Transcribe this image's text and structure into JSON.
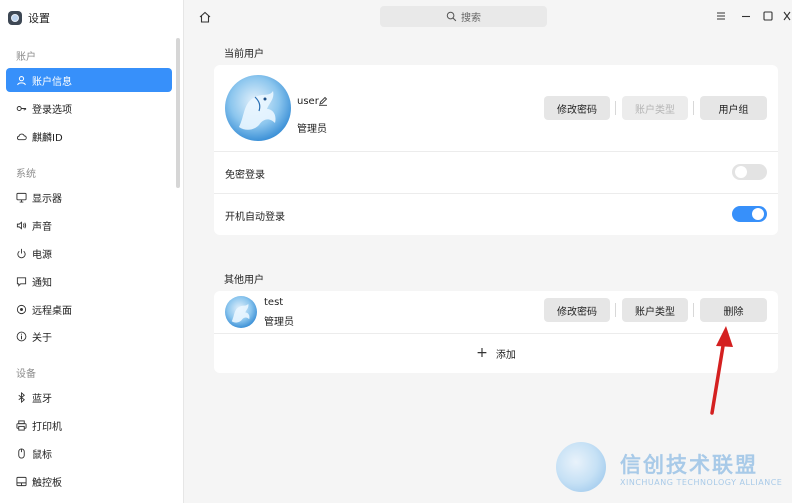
{
  "app": {
    "title": "设置"
  },
  "search": {
    "placeholder": "搜索"
  },
  "sidebar": {
    "groups": [
      {
        "label": "账户"
      },
      {
        "label": "系统"
      },
      {
        "label": "设备"
      }
    ],
    "items": [
      {
        "label": "账户信息",
        "icon": "user-icon",
        "active": true
      },
      {
        "label": "登录选项",
        "icon": "key-icon"
      },
      {
        "label": "麒麟ID",
        "icon": "cloud-icon"
      },
      {
        "label": "显示器",
        "icon": "monitor-icon"
      },
      {
        "label": "声音",
        "icon": "speaker-icon"
      },
      {
        "label": "电源",
        "icon": "power-icon"
      },
      {
        "label": "通知",
        "icon": "message-icon"
      },
      {
        "label": "远程桌面",
        "icon": "remote-desktop-icon"
      },
      {
        "label": "关于",
        "icon": "info-icon"
      },
      {
        "label": "蓝牙",
        "icon": "bluetooth-icon"
      },
      {
        "label": "打印机",
        "icon": "printer-icon"
      },
      {
        "label": "鼠标",
        "icon": "mouse-icon"
      },
      {
        "label": "触控板",
        "icon": "touchpad-icon"
      }
    ]
  },
  "current_user": {
    "section_title": "当前用户",
    "username": "user",
    "role": "管理员",
    "buttons": {
      "change_password": "修改密码",
      "account_type": "账户类型",
      "user_group": "用户组"
    },
    "passwordless_login": {
      "label": "免密登录",
      "enabled": false
    },
    "auto_login": {
      "label": "开机自动登录",
      "enabled": true
    }
  },
  "other_users": {
    "section_title": "其他用户",
    "users": [
      {
        "username": "test",
        "role": "管理员",
        "buttons": {
          "change_password": "修改密码",
          "account_type": "账户类型",
          "delete": "删除"
        }
      }
    ],
    "add_label": "添加"
  },
  "watermark": {
    "title": "信创技术联盟",
    "subtitle": "XINCHUANG TECHNOLOGY ALLIANCE"
  },
  "colors": {
    "accent": "#3790fa",
    "sidebar_bg": "#ffffff",
    "content_bg": "#f5f5f5",
    "annotation_arrow": "#d42020"
  }
}
